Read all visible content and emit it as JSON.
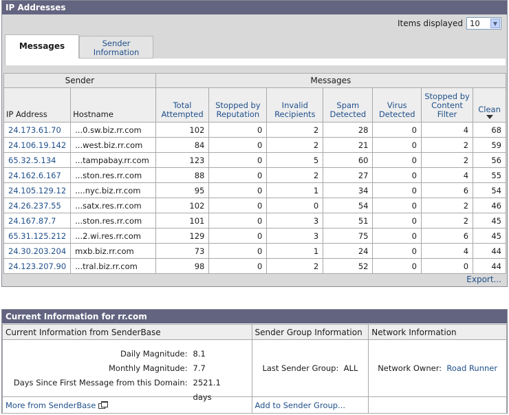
{
  "ip_panel": {
    "title": "IP Addresses",
    "items_displayed_label": "Items displayed",
    "items_displayed_value": "10",
    "tabs": [
      {
        "label": "Messages",
        "active": true
      },
      {
        "label_line1": "Sender",
        "label_line2": "Information",
        "active": false
      }
    ],
    "group_headers": {
      "sender": "Sender",
      "messages": "Messages"
    },
    "columns": {
      "ip": "IP Address",
      "hostname": "Hostname",
      "total_1": "Total",
      "total_2": "Attempted",
      "stopped_1": "Stopped by",
      "stopped_2": "Reputation",
      "invalid_1": "Invalid",
      "invalid_2": "Recipients",
      "spam_1": "Spam",
      "spam_2": "Detected",
      "virus_1": "Virus",
      "virus_2": "Detected",
      "content_1": "Stopped by",
      "content_2": "Content",
      "content_3": "Filter",
      "clean": "Clean"
    },
    "rows": [
      {
        "ip": "24.173.61.70",
        "hostname": "...0.sw.biz.rr.com",
        "total": "102",
        "stopped": "0",
        "invalid": "2",
        "spam": "28",
        "virus": "0",
        "content": "4",
        "clean": "68"
      },
      {
        "ip": "24.106.19.142",
        "hostname": "...west.biz.rr.com",
        "total": "84",
        "stopped": "0",
        "invalid": "2",
        "spam": "21",
        "virus": "0",
        "content": "2",
        "clean": "59"
      },
      {
        "ip": "65.32.5.134",
        "hostname": "...tampabay.rr.com",
        "total": "123",
        "stopped": "0",
        "invalid": "5",
        "spam": "60",
        "virus": "0",
        "content": "2",
        "clean": "56"
      },
      {
        "ip": "24.162.6.167",
        "hostname": "...ston.res.rr.com",
        "total": "88",
        "stopped": "0",
        "invalid": "2",
        "spam": "27",
        "virus": "0",
        "content": "4",
        "clean": "55"
      },
      {
        "ip": "24.105.129.12",
        "hostname": "....nyc.biz.rr.com",
        "total": "95",
        "stopped": "0",
        "invalid": "1",
        "spam": "34",
        "virus": "0",
        "content": "6",
        "clean": "54"
      },
      {
        "ip": "24.26.237.55",
        "hostname": "...satx.res.rr.com",
        "total": "102",
        "stopped": "0",
        "invalid": "0",
        "spam": "54",
        "virus": "0",
        "content": "2",
        "clean": "46"
      },
      {
        "ip": "24.167.87.7",
        "hostname": "...ston.res.rr.com",
        "total": "101",
        "stopped": "0",
        "invalid": "3",
        "spam": "51",
        "virus": "0",
        "content": "2",
        "clean": "45"
      },
      {
        "ip": "65.31.125.212",
        "hostname": "...2.wi.res.rr.com",
        "total": "129",
        "stopped": "0",
        "invalid": "3",
        "spam": "75",
        "virus": "0",
        "content": "6",
        "clean": "45"
      },
      {
        "ip": "24.30.203.204",
        "hostname": "mxb.biz.rr.com",
        "total": "73",
        "stopped": "0",
        "invalid": "1",
        "spam": "24",
        "virus": "0",
        "content": "4",
        "clean": "44"
      },
      {
        "ip": "24.123.207.90",
        "hostname": "...tral.biz.rr.com",
        "total": "98",
        "stopped": "0",
        "invalid": "2",
        "spam": "52",
        "virus": "0",
        "content": "0",
        "clean": "44"
      }
    ],
    "export_label": "Export..."
  },
  "info_panel": {
    "title": "Current Information for rr.com",
    "headers": {
      "senderbase": "Current Information from SenderBase",
      "sender_group": "Sender Group Information",
      "network": "Network Information"
    },
    "senderbase": {
      "daily_label": "Daily Magnitude:",
      "daily_value": "8.1",
      "monthly_label": "Monthly Magnitude:",
      "monthly_value": "7.7",
      "days_label": "Days Since First Message from this Domain:",
      "days_value": "2521.1 days"
    },
    "sender_group": {
      "label": "Last Sender Group:",
      "value": "ALL"
    },
    "network": {
      "label": "Network Owner:",
      "value": "Road Runner"
    },
    "footer": {
      "more": "More from SenderBase",
      "add": "Add to Sender Group..."
    }
  }
}
